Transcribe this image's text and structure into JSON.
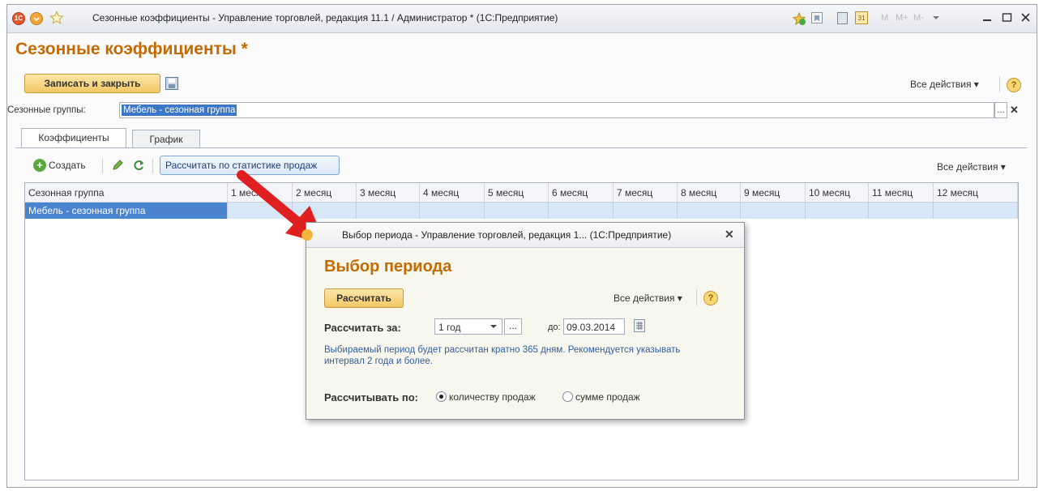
{
  "window": {
    "title": "Сезонные коэффициенты - Управление торговлей, редакция 11.1 / Администратор * (1С:Предприятие)",
    "toolbar_buttons": [
      "M",
      "M+",
      "M-"
    ]
  },
  "form": {
    "title": "Сезонные коэффициенты *",
    "save_close_label": "Записать и закрыть",
    "all_actions_label": "Все действия ▾",
    "help_label": "?"
  },
  "seasonal_group_field": {
    "label": "Сезонные группы:",
    "value": "Мебель - сезонная группа",
    "choose_label": "...",
    "clear_label": "✕"
  },
  "tabs": [
    {
      "label": "Коэффициенты",
      "active": true
    },
    {
      "label": "График",
      "active": false
    }
  ],
  "table_toolbar": {
    "create_label": "Создать",
    "calc_stats_label": "Рассчитать по статистике продаж",
    "all_actions_label": "Все действия ▾"
  },
  "table": {
    "columns": [
      "Сезонная группа",
      "1 месяц",
      "2 месяц",
      "3 месяц",
      "4 месяц",
      "5 месяц",
      "6 месяц",
      "7 месяц",
      "8 месяц",
      "9 месяц",
      "10 месяц",
      "11 месяц",
      "12 месяц"
    ],
    "rows": [
      [
        "Мебель - сезонная группа",
        "",
        "",
        "",
        "",
        "",
        "",
        "",
        "",
        "",
        "",
        "",
        ""
      ]
    ]
  },
  "dialog": {
    "window_title": "Выбор периода - Управление торговлей, редакция 1... (1С:Предприятие)",
    "close_label": "✕",
    "title": "Выбор периода",
    "calc_button_label": "Рассчитать",
    "all_actions_label": "Все действия ▾",
    "help_label": "?",
    "period_label": "Рассчитать за:",
    "period_value": "1 год",
    "period_choose_label": "...",
    "to_label": "до:",
    "to_date": "09.03.2014",
    "hint": "Выбираемый период будет рассчитан кратно 365 дням. Рекомендуется указывать интервал 2 года и более.",
    "calc_by_label": "Рассчитывать по:",
    "radio_options": [
      {
        "label": "количеству продаж",
        "checked": true
      },
      {
        "label": "сумме продаж",
        "checked": false
      }
    ]
  },
  "colors": {
    "accent_orange": "#c66a00",
    "selection_blue": "#3b77c9",
    "arrow_red": "#e02020"
  }
}
